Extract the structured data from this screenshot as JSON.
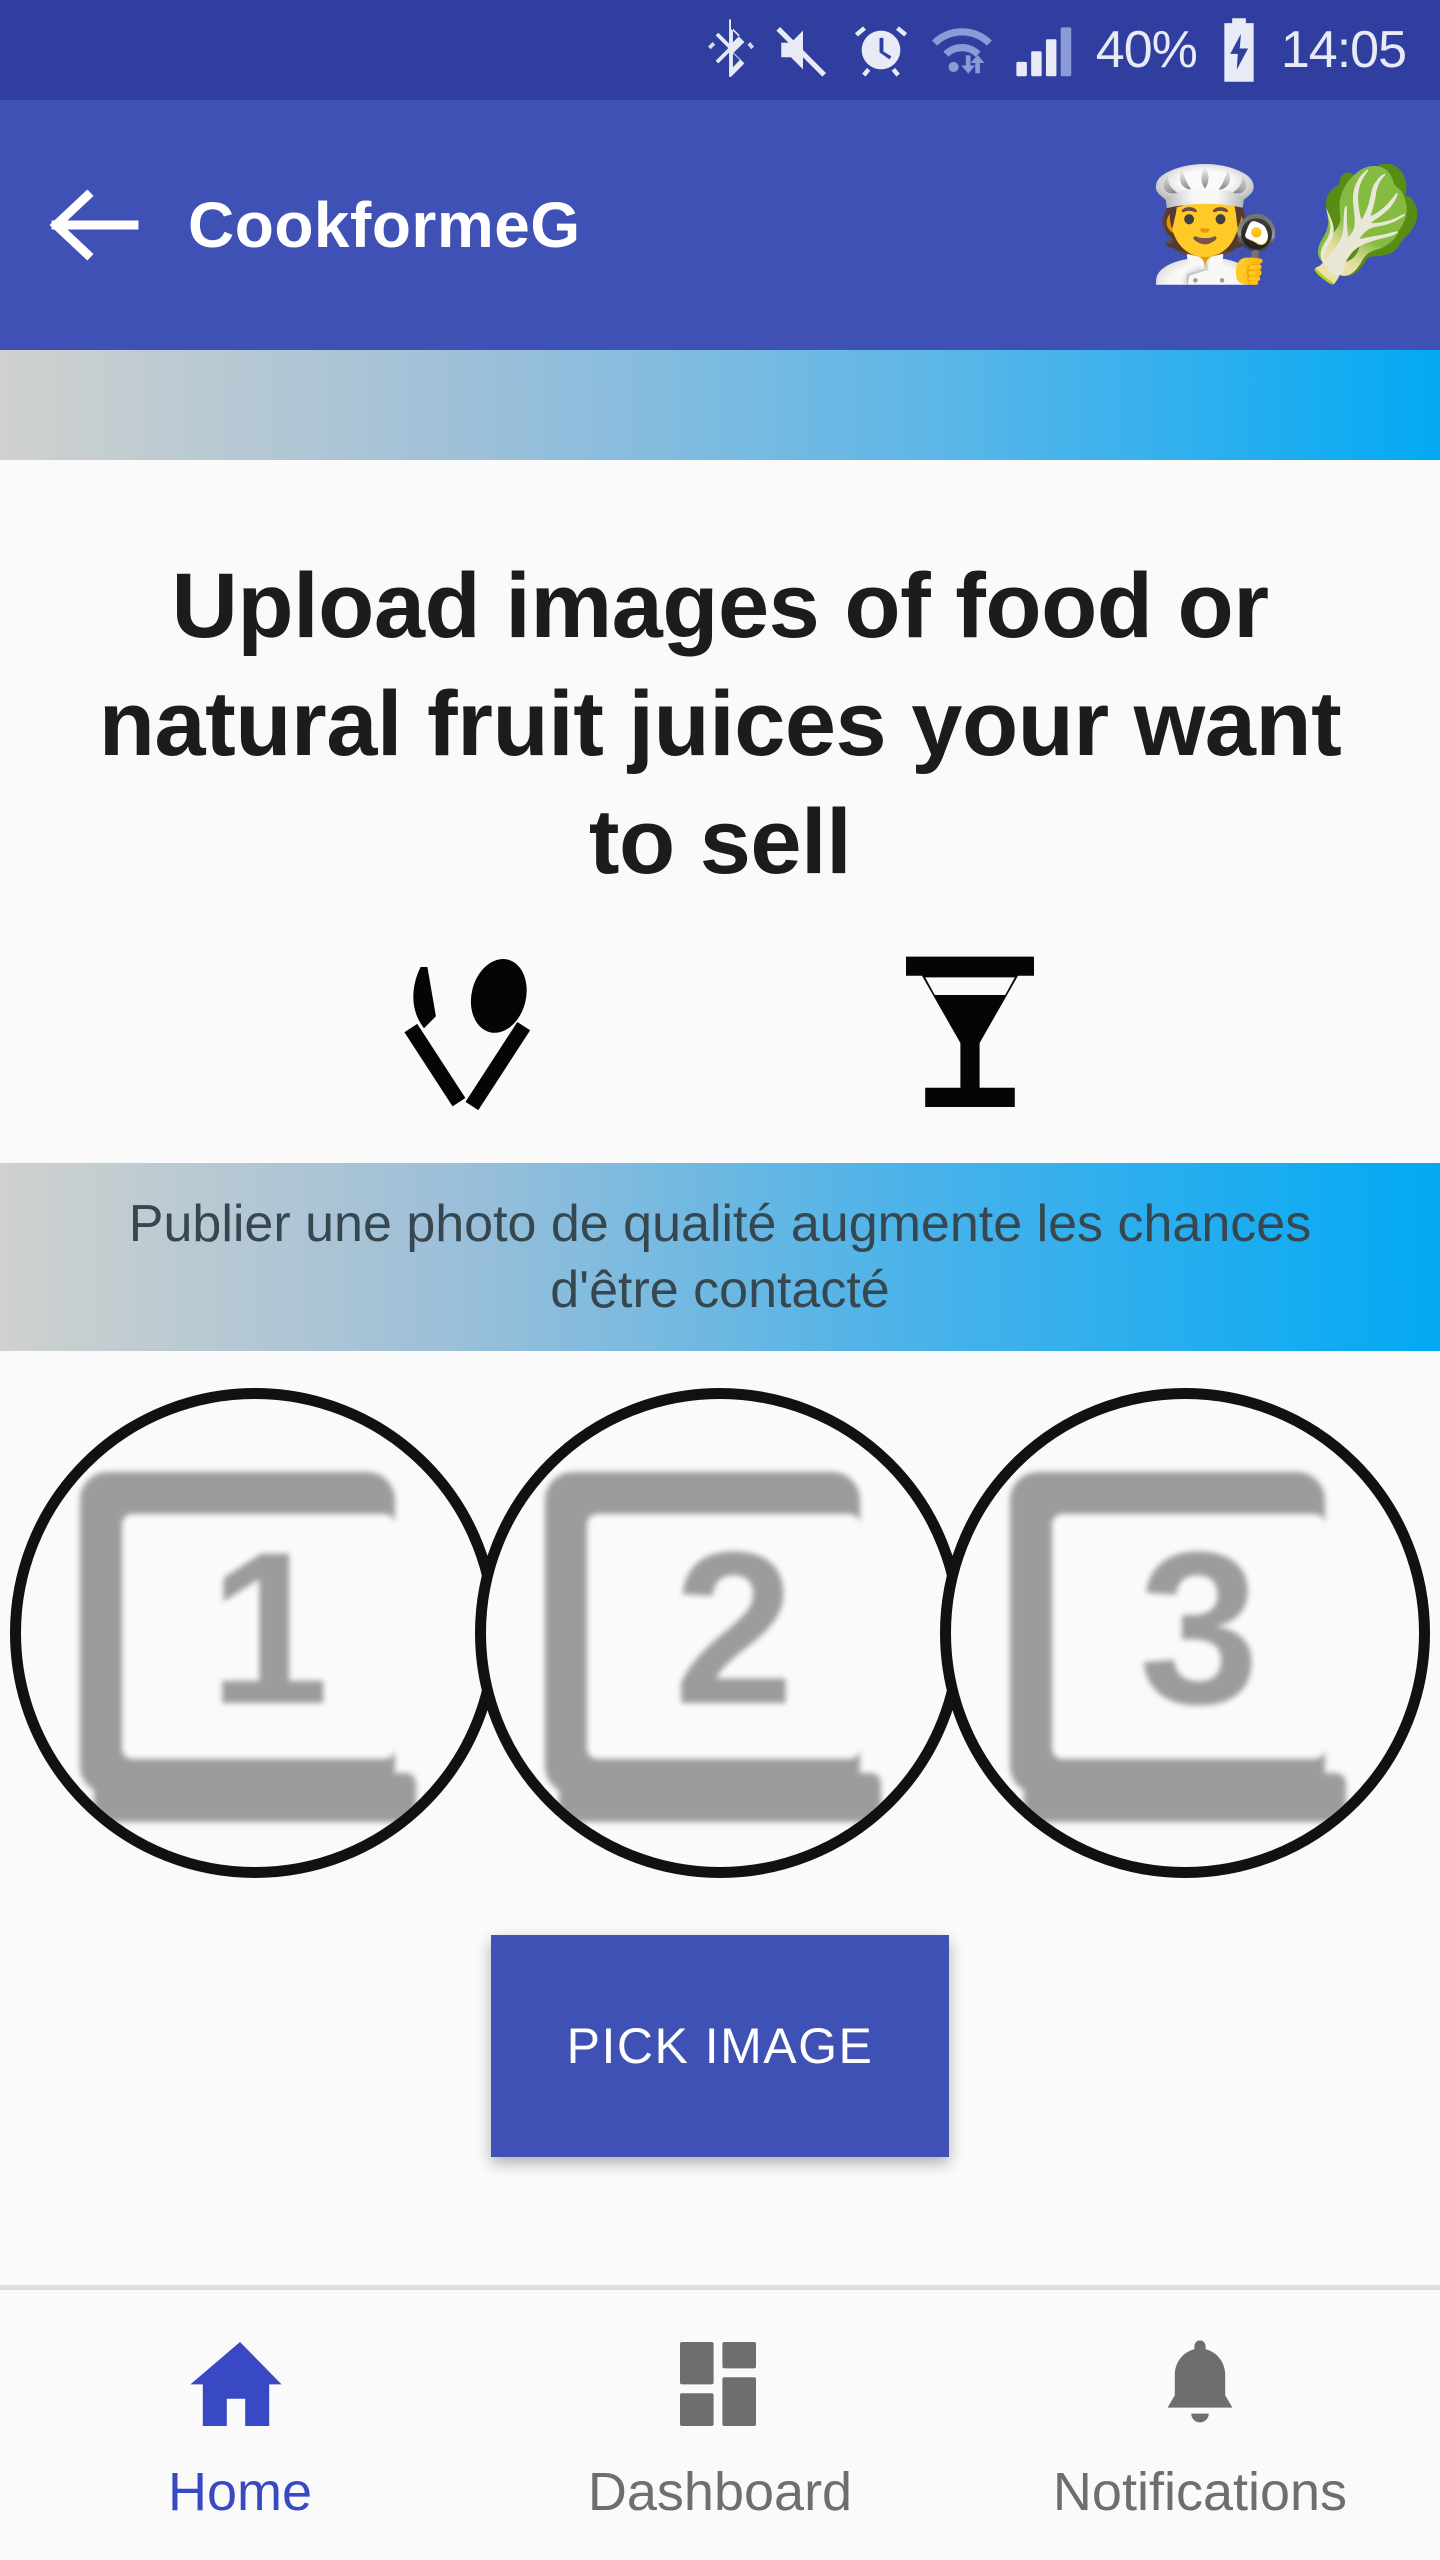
{
  "status_bar": {
    "icons": [
      "bluetooth-icon",
      "volume-mute-icon",
      "alarm-icon",
      "wifi-icon",
      "cellular-signal-icon"
    ],
    "battery_percent": "40%",
    "battery_state": "charging",
    "time": "14:05"
  },
  "app_bar": {
    "back_label": "back-arrow",
    "title": "CookformeG",
    "emoji_cook": "🧑‍🍳",
    "emoji_leafy": "🥬"
  },
  "main": {
    "heading": "Upload images of food or natural fruit juices your want to sell",
    "icons": [
      {
        "name": "fork-spoon-icon",
        "glyph": "🍴"
      },
      {
        "name": "cocktail-glass-icon",
        "glyph": "🍸"
      }
    ],
    "hint_fr": "Publier une photo de qualité augmente les chances d'être contacté",
    "placeholders": [
      {
        "label": "1",
        "name": "image-slot-1"
      },
      {
        "label": "2",
        "name": "image-slot-2"
      },
      {
        "label": "3",
        "name": "image-slot-3"
      }
    ],
    "pick_button": "PICK IMAGE"
  },
  "bottom_nav": {
    "items": [
      {
        "label": "Home",
        "icon": "home-icon",
        "active": true
      },
      {
        "label": "Dashboard",
        "icon": "dashboard-grid-icon",
        "active": false
      },
      {
        "label": "Notifications",
        "icon": "bell-icon",
        "active": false
      }
    ]
  },
  "colors": {
    "status_bar": "#303F9F",
    "app_bar": "#3F51B5",
    "accent_blue": "#03A9F4",
    "button": "#3F51B5",
    "nav_active": "#3949C4",
    "nav_inactive": "#6E6E6E",
    "background": "#FAFAFA"
  }
}
